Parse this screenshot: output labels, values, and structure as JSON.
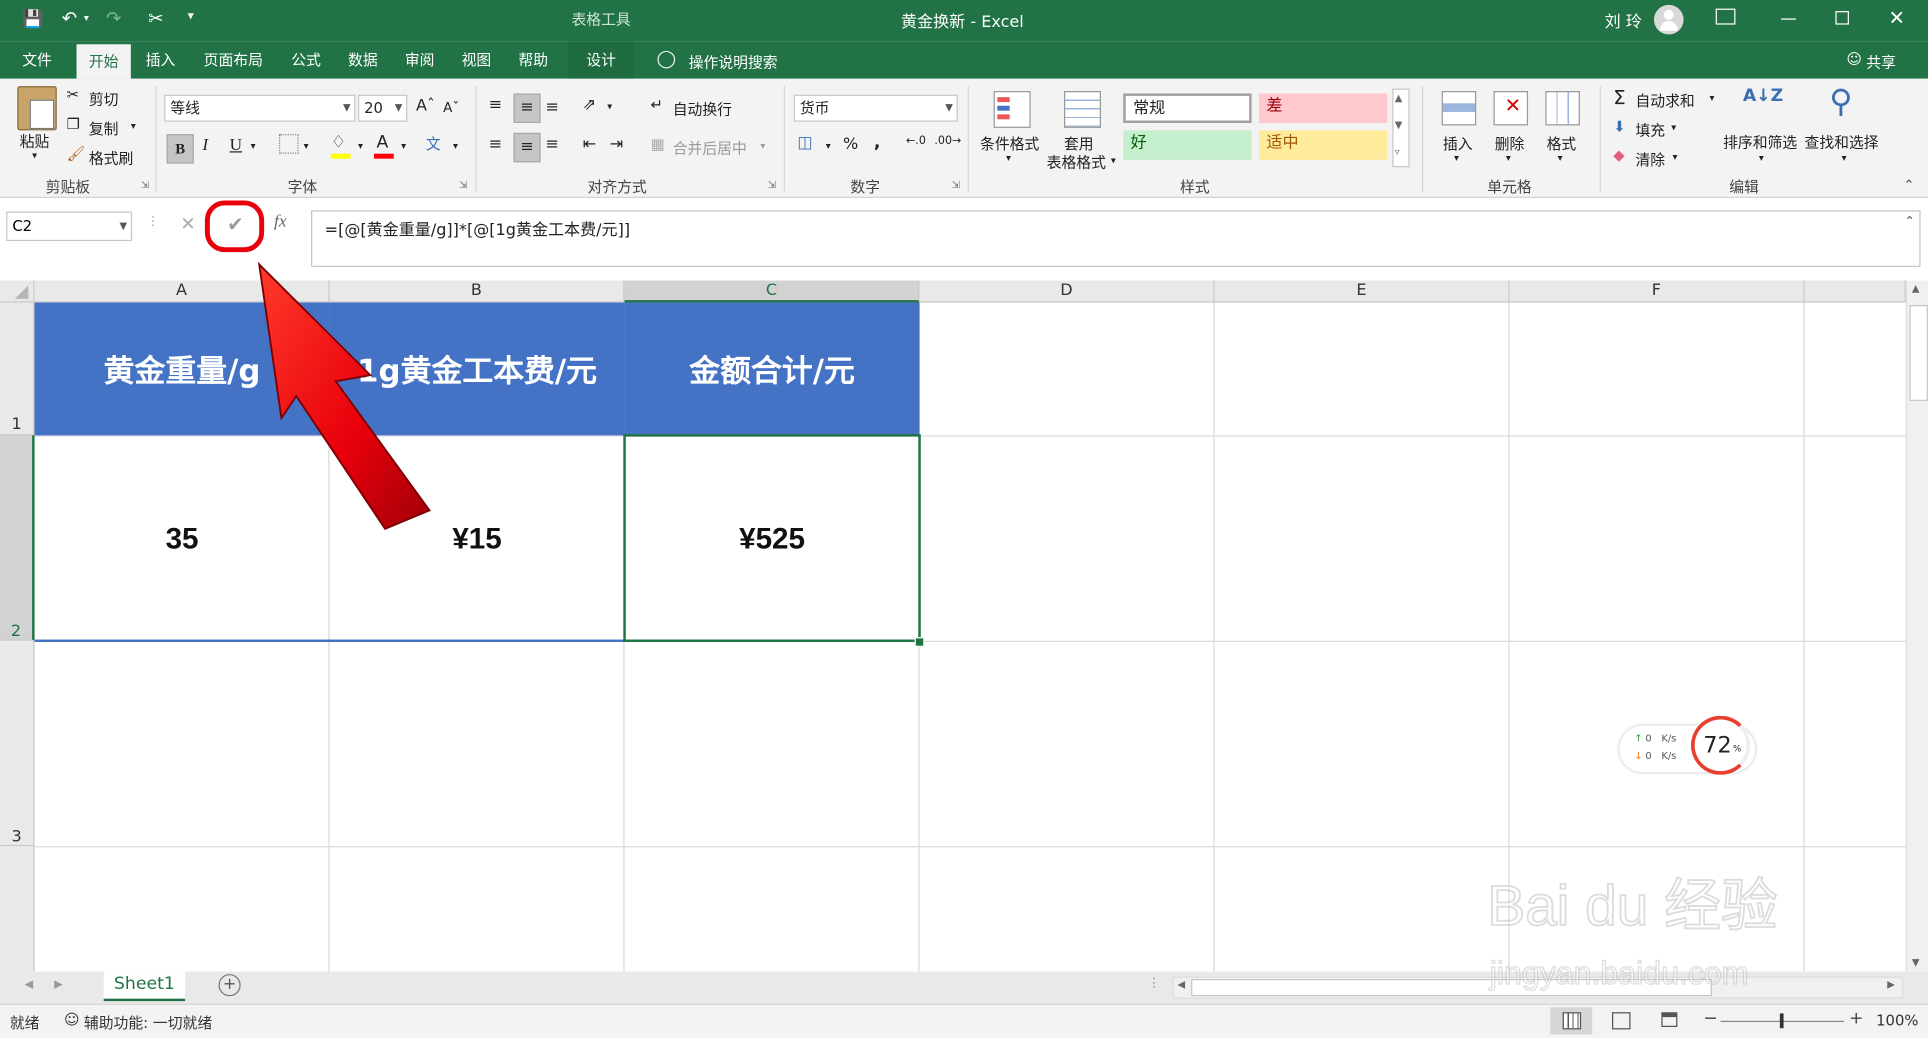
{
  "window": {
    "title": "黄金换新  -  Excel",
    "context_tab_group": "表格工具",
    "user_name": "刘 玲"
  },
  "ribbon_tabs": [
    "文件",
    "开始",
    "插入",
    "页面布局",
    "公式",
    "数据",
    "审阅",
    "视图",
    "帮助",
    "设计"
  ],
  "tell_me": "操作说明搜索",
  "share": "共享",
  "clipboard": {
    "paste": "粘贴",
    "cut": "剪切",
    "copy": "复制",
    "format_painter": "格式刷",
    "group": "剪贴板"
  },
  "font": {
    "name": "等线",
    "size": "20",
    "bold": "B",
    "italic": "I",
    "underline": "U",
    "group": "字体"
  },
  "alignment": {
    "wrap": "自动换行",
    "merge": "合并后居中",
    "group": "对齐方式"
  },
  "number": {
    "format": "货币",
    "percent": "%",
    "comma": ",",
    "group": "数字"
  },
  "styles": {
    "conditional": "条件格式",
    "table_format_1": "套用",
    "table_format_2": "表格格式",
    "normal": "常规",
    "bad": "差",
    "good": "好",
    "neutral": "适中",
    "group": "样式"
  },
  "cells": {
    "insert": "插入",
    "delete": "删除",
    "format": "格式",
    "group": "单元格"
  },
  "editing": {
    "autosum": "自动求和",
    "fill": "填充",
    "clear": "清除",
    "sort": "排序和筛选",
    "find": "查找和选择",
    "group": "编辑"
  },
  "formula_bar": {
    "name_box": "C2",
    "fx": "fx",
    "formula": "=[@[黄金重量/g]]*[@[1g黄金工本费/元]]"
  },
  "columns": [
    "A",
    "B",
    "C",
    "D",
    "E",
    "F"
  ],
  "rows": [
    "1",
    "2",
    "3"
  ],
  "table": {
    "headers": [
      "黄金重量/g",
      "1g黄金工本费/元",
      "金额合计/元"
    ],
    "values": [
      "35",
      "¥15",
      "¥525"
    ]
  },
  "net_widget": {
    "up": "0",
    "down": "0",
    "unit": "K/s",
    "percent": "72",
    "percent_sign": "%"
  },
  "sheet_tab": "Sheet1",
  "status": {
    "ready": "就绪",
    "accessibility": "辅助功能: 一切就绪",
    "zoom": "100%"
  },
  "watermark": {
    "text": "Bai du 经验",
    "url": "jingyan.baidu.com"
  },
  "colors": {
    "excel_green": "#217346",
    "table_header": "#4472c4",
    "annotation_red": "#e8000b"
  }
}
